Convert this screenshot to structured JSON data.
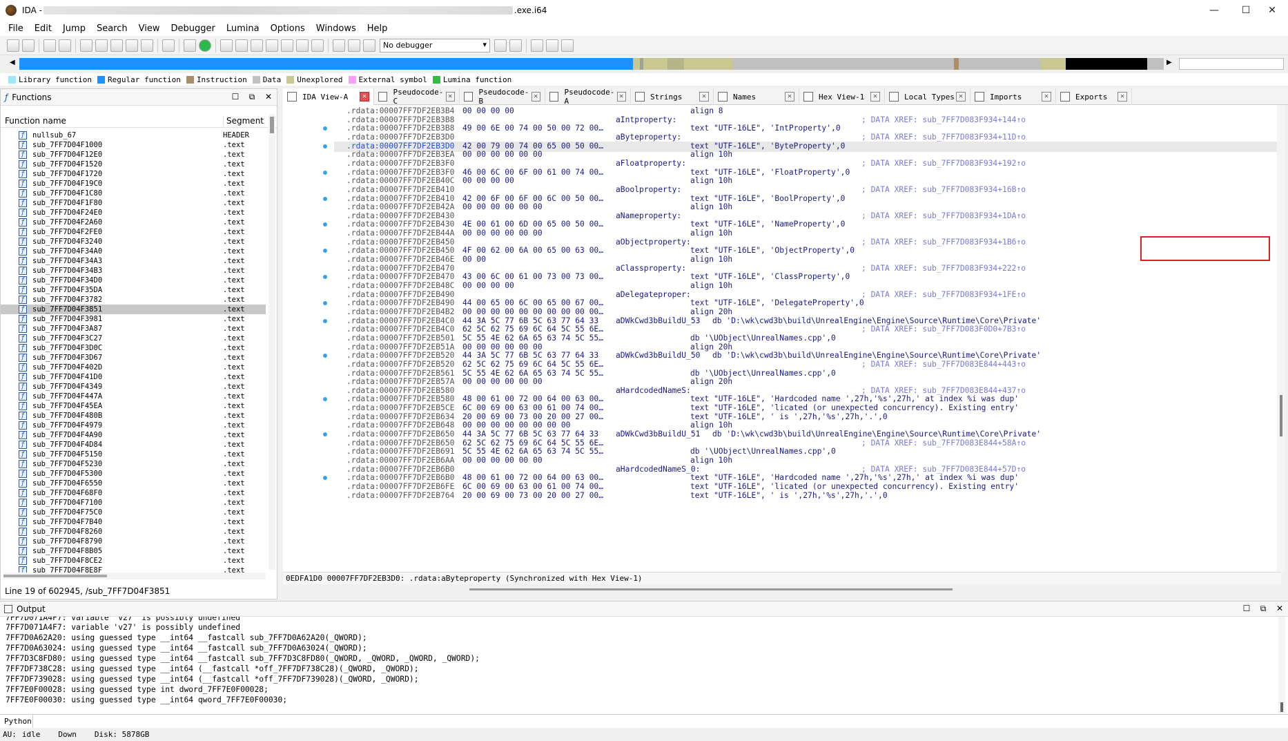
{
  "window": {
    "title_prefix": "IDA - ",
    "title_suffix": ".exe.i64",
    "min": "—",
    "max": "☐",
    "close": "✕"
  },
  "menu": [
    "File",
    "Edit",
    "Jump",
    "Search",
    "View",
    "Debugger",
    "Lumina",
    "Options",
    "Windows",
    "Help"
  ],
  "toolbar": {
    "debugger": "No debugger"
  },
  "legend": [
    {
      "label": "Library function",
      "color": "#a0e8f8"
    },
    {
      "label": "Regular function",
      "color": "#1e90ff"
    },
    {
      "label": "Instruction",
      "color": "#a88f6c"
    },
    {
      "label": "Data",
      "color": "#c0c0c0"
    },
    {
      "label": "Unexplored",
      "color": "#c8c890"
    },
    {
      "label": "External symbol",
      "color": "#ff9cf8"
    },
    {
      "label": "Lumina function",
      "color": "#30c040"
    }
  ],
  "functions": {
    "title": "Functions",
    "col_name": "Function name",
    "col_segment": "Segment",
    "selected_index": 18,
    "rows": [
      {
        "name": "nullsub_67",
        "seg": "HEADER"
      },
      {
        "name": "sub_7FF7D04F1000",
        "seg": ".text"
      },
      {
        "name": "sub_7FF7D04F12E0",
        "seg": ".text"
      },
      {
        "name": "sub_7FF7D04F1520",
        "seg": ".text"
      },
      {
        "name": "sub_7FF7D04F1720",
        "seg": ".text"
      },
      {
        "name": "sub_7FF7D04F19C0",
        "seg": ".text"
      },
      {
        "name": "sub_7FF7D04F1C80",
        "seg": ".text"
      },
      {
        "name": "sub_7FF7D04F1F80",
        "seg": ".text"
      },
      {
        "name": "sub_7FF7D04F24E0",
        "seg": ".text"
      },
      {
        "name": "sub_7FF7D04F2A60",
        "seg": ".text"
      },
      {
        "name": "sub_7FF7D04F2FE0",
        "seg": ".text"
      },
      {
        "name": "sub_7FF7D04F3240",
        "seg": ".text"
      },
      {
        "name": "sub_7FF7D04F34A0",
        "seg": ".text"
      },
      {
        "name": "sub_7FF7D04F34A3",
        "seg": ".text"
      },
      {
        "name": "sub_7FF7D04F34B3",
        "seg": ".text"
      },
      {
        "name": "sub_7FF7D04F34D0",
        "seg": ".text"
      },
      {
        "name": "sub_7FF7D04F35DA",
        "seg": ".text"
      },
      {
        "name": "sub_7FF7D04F3782",
        "seg": ".text"
      },
      {
        "name": "sub_7FF7D04F3851",
        "seg": ".text"
      },
      {
        "name": "sub_7FF7D04F3981",
        "seg": ".text"
      },
      {
        "name": "sub_7FF7D04F3A87",
        "seg": ".text"
      },
      {
        "name": "sub_7FF7D04F3C27",
        "seg": ".text"
      },
      {
        "name": "sub_7FF7D04F3D0C",
        "seg": ".text"
      },
      {
        "name": "sub_7FF7D04F3D67",
        "seg": ".text"
      },
      {
        "name": "sub_7FF7D04F402D",
        "seg": ".text"
      },
      {
        "name": "sub_7FF7D04F41D0",
        "seg": ".text"
      },
      {
        "name": "sub_7FF7D04F4349",
        "seg": ".text"
      },
      {
        "name": "sub_7FF7D04F447A",
        "seg": ".text"
      },
      {
        "name": "sub_7FF7D04F45EA",
        "seg": ".text"
      },
      {
        "name": "sub_7FF7D04F480B",
        "seg": ".text"
      },
      {
        "name": "sub_7FF7D04F4979",
        "seg": ".text"
      },
      {
        "name": "sub_7FF7D04F4A90",
        "seg": ".text"
      },
      {
        "name": "sub_7FF7D04F4D84",
        "seg": ".text"
      },
      {
        "name": "sub_7FF7D04F5150",
        "seg": ".text"
      },
      {
        "name": "sub_7FF7D04F5230",
        "seg": ".text"
      },
      {
        "name": "sub_7FF7D04F5300",
        "seg": ".text"
      },
      {
        "name": "sub_7FF7D04F6550",
        "seg": ".text"
      },
      {
        "name": "sub_7FF7D04F68F0",
        "seg": ".text"
      },
      {
        "name": "sub_7FF7D04F7100",
        "seg": ".text"
      },
      {
        "name": "sub_7FF7D04F75C0",
        "seg": ".text"
      },
      {
        "name": "sub_7FF7D04F7B40",
        "seg": ".text"
      },
      {
        "name": "sub_7FF7D04F8260",
        "seg": ".text"
      },
      {
        "name": "sub_7FF7D04F8790",
        "seg": ".text"
      },
      {
        "name": "sub_7FF7D04F8B05",
        "seg": ".text"
      },
      {
        "name": "sub_7FF7D04F8CE2",
        "seg": ".text"
      },
      {
        "name": "sub_7FF7D04F8E8F",
        "seg": ".text"
      }
    ],
    "status": "Line 19 of 602945, /sub_7FF7D04F3851"
  },
  "tabs": [
    {
      "label": "IDA View-A",
      "active": true
    },
    {
      "label": "Pseudocode-C"
    },
    {
      "label": "Pseudocode-B"
    },
    {
      "label": "Pseudocode-A"
    },
    {
      "label": "Strings"
    },
    {
      "label": "Names"
    },
    {
      "label": "Hex View-1"
    },
    {
      "label": "Local Types"
    },
    {
      "label": "Imports"
    },
    {
      "label": "Exports"
    }
  ],
  "disasm": [
    {
      "addr": ".rdata:00007FF7DF2EB3B4",
      "hex": "00 00 00 00",
      "ins": "align 8"
    },
    {
      "addr": ".rdata:00007FF7DF2EB3B8",
      "label": "aIntproperty:",
      "xref": "; DATA XREF: sub_7FF7D083F934+144↑o"
    },
    {
      "addr": ".rdata:00007FF7DF2EB3B8",
      "hex": "49 00 6E 00 74 00 50 00 72 00…",
      "ins": "text \"UTF-16LE\", 'IntProperty',0",
      "dot": true
    },
    {
      "addr": ".rdata:00007FF7DF2EB3D0",
      "label": "aByteproperty:",
      "xref": "; DATA XREF: sub_7FF7D083F934+11D↑o"
    },
    {
      "addr": ".rdata:00007FF7DF2EB3D0",
      "hex": "42 00 79 00 74 00 65 00 50 00…",
      "ins": "text \"UTF-16LE\", 'ByteProperty',0",
      "hl": true,
      "dot": true
    },
    {
      "addr": ".rdata:00007FF7DF2EB3EA",
      "hex": "00 00 00 00 00 00",
      "ins": "align 10h"
    },
    {
      "addr": ".rdata:00007FF7DF2EB3F0",
      "label": "aFloatproperty:",
      "xref": "; DATA XREF: sub_7FF7D083F934+192↑o"
    },
    {
      "addr": ".rdata:00007FF7DF2EB3F0",
      "hex": "46 00 6C 00 6F 00 61 00 74 00…",
      "ins": "text \"UTF-16LE\", 'FloatProperty',0",
      "dot": true
    },
    {
      "addr": ".rdata:00007FF7DF2EB40C",
      "hex": "00 00 00 00",
      "ins": "align 10h"
    },
    {
      "addr": ".rdata:00007FF7DF2EB410",
      "label": "aBoolproperty:",
      "xref": "; DATA XREF: sub_7FF7D083F934+16B↑o"
    },
    {
      "addr": ".rdata:00007FF7DF2EB410",
      "hex": "42 00 6F 00 6F 00 6C 00 50 00…",
      "ins": "text \"UTF-16LE\", 'BoolProperty',0",
      "dot": true
    },
    {
      "addr": ".rdata:00007FF7DF2EB42A",
      "hex": "00 00 00 00 00 00",
      "ins": "align 10h"
    },
    {
      "addr": ".rdata:00007FF7DF2EB430",
      "label": "aNameproperty:",
      "xref": "; DATA XREF: sub_7FF7D083F934+1DA↑o"
    },
    {
      "addr": ".rdata:00007FF7DF2EB430",
      "hex": "4E 00 61 00 6D 00 65 00 50 00…",
      "ins": "text \"UTF-16LE\", 'NameProperty',0",
      "dot": true
    },
    {
      "addr": ".rdata:00007FF7DF2EB44A",
      "hex": "00 00 00 00 00 00",
      "ins": "align 10h"
    },
    {
      "addr": ".rdata:00007FF7DF2EB450",
      "label": "aObjectproperty:",
      "xref": "; DATA XREF: sub_7FF7D083F934+1B6↑o"
    },
    {
      "addr": ".rdata:00007FF7DF2EB450",
      "hex": "4F 00 62 00 6A 00 65 00 63 00…",
      "ins": "text \"UTF-16LE\", 'ObjectProperty',0",
      "dot": true
    },
    {
      "addr": ".rdata:00007FF7DF2EB46E",
      "hex": "00 00",
      "ins": "align 10h"
    },
    {
      "addr": ".rdata:00007FF7DF2EB470",
      "label": "aClassproperty:",
      "xref": "; DATA XREF: sub_7FF7D083F934+222↑o"
    },
    {
      "addr": ".rdata:00007FF7DF2EB470",
      "hex": "43 00 6C 00 61 00 73 00 73 00…",
      "ins": "text \"UTF-16LE\", 'ClassProperty',0",
      "dot": true
    },
    {
      "addr": ".rdata:00007FF7DF2EB48C",
      "hex": "00 00 00 00",
      "ins": "align 10h"
    },
    {
      "addr": ".rdata:00007FF7DF2EB490",
      "label": "aDelegateproper:",
      "xref": "; DATA XREF: sub_7FF7D083F934+1FE↑o"
    },
    {
      "addr": ".rdata:00007FF7DF2EB490",
      "hex": "44 00 65 00 6C 00 65 00 67 00…",
      "ins": "text \"UTF-16LE\", 'DelegateProperty',0",
      "dot": true
    },
    {
      "addr": ".rdata:00007FF7DF2EB4B2",
      "hex": "00 00 00 00 00 00 00 00 00 00…",
      "ins": "align 20h"
    },
    {
      "addr": ".rdata:00007FF7DF2EB4C0",
      "hex": "44 3A 5C 77 6B 5C 63 77 64 33",
      "label": "aDWkCwd3bBuildU_53",
      "ins": "db 'D:\\wk\\cwd3b\\build\\UnrealEngine\\Engine\\Source\\Runtime\\Core\\Private'",
      "dot": true
    },
    {
      "addr": ".rdata:00007FF7DF2EB4C0",
      "hex": "62 5C 62 75 69 6C 64 5C 55 6E…",
      "xref": "; DATA XREF: sub_7FF7D083F0D0+7B3↑o"
    },
    {
      "addr": ".rdata:00007FF7DF2EB501",
      "hex": "5C 55 4E 62 6A 65 63 74 5C 55…",
      "ins": "db '\\UObject\\UnrealNames.cpp',0"
    },
    {
      "addr": ".rdata:00007FF7DF2EB51A",
      "hex": "00 00 00 00 00 00",
      "ins": "align 20h"
    },
    {
      "addr": ".rdata:00007FF7DF2EB520",
      "hex": "44 3A 5C 77 6B 5C 63 77 64 33",
      "label": "aDWkCwd3bBuildU_50",
      "ins": "db 'D:\\wk\\cwd3b\\build\\UnrealEngine\\Engine\\Source\\Runtime\\Core\\Private'",
      "dot": true
    },
    {
      "addr": ".rdata:00007FF7DF2EB520",
      "hex": "62 5C 62 75 69 6C 64 5C 55 6E…",
      "xref": "; DATA XREF: sub_7FF7D083E844+443↑o"
    },
    {
      "addr": ".rdata:00007FF7DF2EB561",
      "hex": "5C 55 4E 62 6A 65 63 74 5C 55…",
      "ins": "db '\\UObject\\UnrealNames.cpp',0"
    },
    {
      "addr": ".rdata:00007FF7DF2EB57A",
      "hex": "00 00 00 00 00 00",
      "ins": "align 20h"
    },
    {
      "addr": ".rdata:00007FF7DF2EB580",
      "label": "aHardcodedNameS:",
      "xref": "; DATA XREF: sub_7FF7D083E844+437↑o"
    },
    {
      "addr": ".rdata:00007FF7DF2EB580",
      "hex": "48 00 61 00 72 00 64 00 63 00…",
      "ins": "text \"UTF-16LE\", 'Hardcoded name ',27h,'%s',27h,' at index %i was dup'",
      "dot": true
    },
    {
      "addr": ".rdata:00007FF7DF2EB5CE",
      "hex": "6C 00 69 00 63 00 61 00 74 00…",
      "ins": "text \"UTF-16LE\", 'licated (or unexpected concurrency). Existing entry'"
    },
    {
      "addr": ".rdata:00007FF7DF2EB634",
      "hex": "20 00 69 00 73 00 20 00 27 00…",
      "ins": "text \"UTF-16LE\", ' is ',27h,'%s',27h,'.',0"
    },
    {
      "addr": ".rdata:00007FF7DF2EB648",
      "hex": "00 00 00 00 00 00 00 00",
      "ins": "align 10h"
    },
    {
      "addr": ".rdata:00007FF7DF2EB650",
      "hex": "44 3A 5C 77 6B 5C 63 77 64 33",
      "label": "aDWkCwd3bBuildU_51",
      "ins": "db 'D:\\wk\\cwd3b\\build\\UnrealEngine\\Engine\\Source\\Runtime\\Core\\Private'",
      "dot": true
    },
    {
      "addr": ".rdata:00007FF7DF2EB650",
      "hex": "62 5C 62 75 69 6C 64 5C 55 6E…",
      "xref": "; DATA XREF: sub_7FF7D083E844+58A↑o"
    },
    {
      "addr": ".rdata:00007FF7DF2EB691",
      "hex": "5C 55 4E 62 6A 65 63 74 5C 55…",
      "ins": "db '\\UObject\\UnrealNames.cpp',0"
    },
    {
      "addr": ".rdata:00007FF7DF2EB6AA",
      "hex": "00 00 00 00 00 00",
      "ins": "align 10h"
    },
    {
      "addr": ".rdata:00007FF7DF2EB6B0",
      "label": "aHardcodedNameS_0:",
      "xref": "; DATA XREF: sub_7FF7D083E844+57D↑o"
    },
    {
      "addr": ".rdata:00007FF7DF2EB6B0",
      "hex": "48 00 61 00 72 00 64 00 63 00…",
      "ins": "text \"UTF-16LE\", 'Hardcoded name ',27h,'%s',27h,' at index %i was dup'",
      "dot": true
    },
    {
      "addr": ".rdata:00007FF7DF2EB6FE",
      "hex": "6C 00 69 00 63 00 61 00 74 00…",
      "ins": "text \"UTF-16LE\", 'licated (or unexpected concurrency). Existing entry'"
    },
    {
      "addr": ".rdata:00007FF7DF2EB764",
      "hex": "20 00 69 00 73 00 20 00 27 00…",
      "ins": "text \"UTF-16LE\", ' is ',27h,'%s',27h,'.',0"
    }
  ],
  "disasm_status": "0EDFA1D0 00007FF7DF2EB3D0: .rdata:aByteproperty (Synchronized with Hex View-1)",
  "output": {
    "title": "Output",
    "lines": [
      "7FF7D071A4F7: variable 'v27' is possibly undefined",
      "7FF7D071A4F7: variable 'v27' is possibly undefined",
      "7FF7D0A62A20: using guessed type __int64 __fastcall sub_7FF7D0A62A20(_QWORD);",
      "7FF7D0A63024: using guessed type __int64 __fastcall sub_7FF7D0A63024(_QWORD);",
      "7FF7D3C8FD80: using guessed type __int64 __fastcall sub_7FF7D3C8FD80(_QWORD, _QWORD, _QWORD, _QWORD);",
      "7FF7DF738C28: using guessed type __int64 (__fastcall *off_7FF7DF738C28)(_QWORD, _QWORD);",
      "7FF7DF739028: using guessed type __int64 (__fastcall *off_7FF7DF739028)(_QWORD, _QWORD);",
      "7FF7E0F00028: using guessed type int dword_7FF7E0F00028;",
      "7FF7E0F00030: using guessed type __int64 qword_7FF7E0F00030;"
    ]
  },
  "python_label": "Python",
  "status": {
    "au": "AU:",
    "state": "idle",
    "dir": "Down",
    "disk": "Disk: 5878GB"
  }
}
